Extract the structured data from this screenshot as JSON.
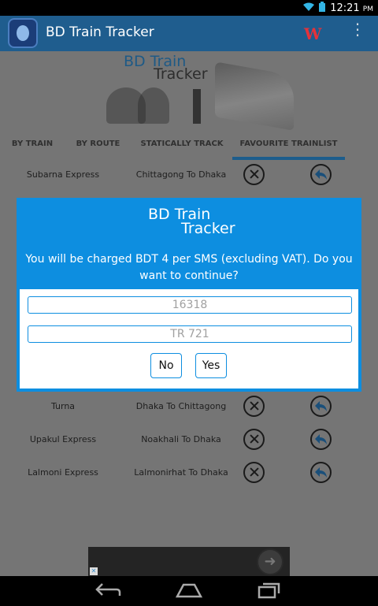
{
  "status_bar": {
    "time": "12:21",
    "meridiem": "PM",
    "icons": [
      "wifi-icon",
      "battery-icon"
    ]
  },
  "action_bar": {
    "title": "BD Train Tracker",
    "logo_letter": "W"
  },
  "banner": {
    "line1": "BD Train",
    "line2": "Tracker"
  },
  "tabs": [
    {
      "label": "BY TRAIN",
      "active": false
    },
    {
      "label": "BY ROUTE",
      "active": false
    },
    {
      "label": "STATICALLY TRACK",
      "active": false
    },
    {
      "label": "FAVOURITE TRAINLIST",
      "active": true
    }
  ],
  "trains": [
    {
      "name": "Subarna Express",
      "route": "Chittagong To Dhaka"
    },
    {
      "name": "Turna",
      "route": "Dhaka To Chittagong"
    },
    {
      "name": "Upakul Express",
      "route": "Noakhali To Dhaka"
    },
    {
      "name": "Lalmoni Express",
      "route": "Lalmonirhat To Dhaka"
    }
  ],
  "dialog": {
    "logo_line1": "BD Train",
    "logo_line2": "Tracker",
    "message": "You will be charged BDT 4 per SMS (excluding VAT). Do you want to continue?",
    "number_field": "16318",
    "text_field": "TR 721",
    "no_label": "No",
    "yes_label": "Yes"
  },
  "colors": {
    "accent": "#0d8ee0",
    "actionbar": "#1f5d8e"
  }
}
